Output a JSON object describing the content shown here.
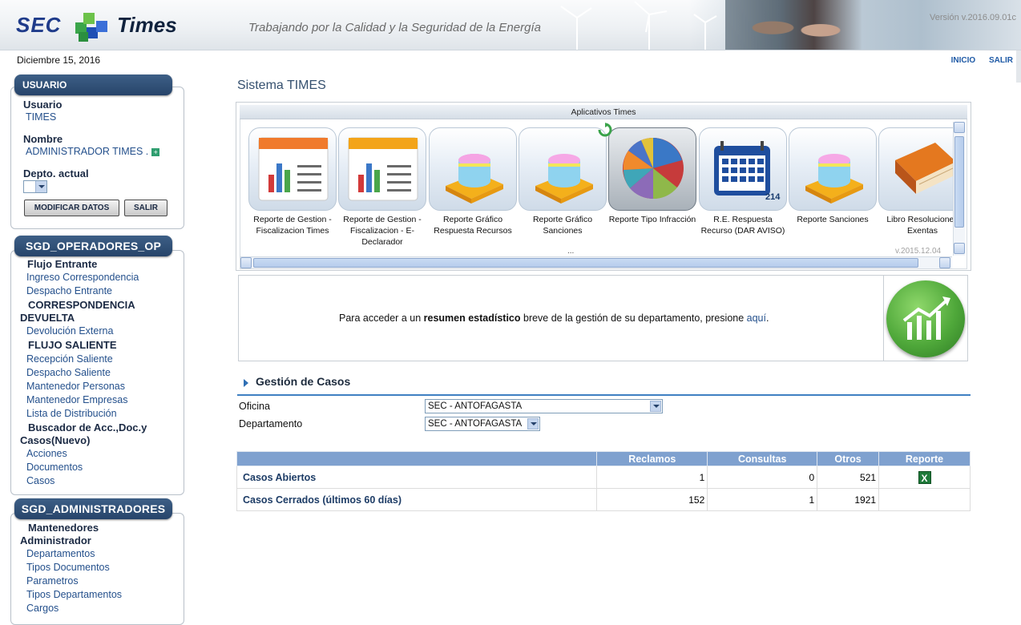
{
  "header": {
    "logo_sec": "SEC",
    "logo_times": "Times",
    "tagline": "Trabajando por la Calidad y la Seguridad de la Energía",
    "version": "Versión v.2016.09.01c"
  },
  "date": "Diciembre 15, 2016",
  "top_links": {
    "inicio": "INICIO",
    "salir": "SALIR"
  },
  "user_panel": {
    "tab": "USUARIO",
    "usuario_label": "Usuario",
    "usuario_value": "TIMES",
    "nombre_label": "Nombre",
    "nombre_value": "ADMINISTRADOR TIMES .",
    "depto_label": "Depto. actual",
    "modificar_button": "MODIFICAR DATOS",
    "salir_button": "SALIR"
  },
  "operadores_panel": {
    "tab": "SGD_OPERADORES_OP",
    "items": {
      "flujo_entrante": "Flujo Entrante",
      "ingreso_correspondencia": "Ingreso Correspondencia",
      "despacho_entrante": "Despacho Entrante",
      "correspondencia_devuelta_1": "CORRESPONDENCIA",
      "correspondencia_devuelta_2": "DEVUELTA",
      "devolucion_externa": "Devolución Externa",
      "flujo_saliente": "FLUJO SALIENTE",
      "recepcion_saliente": "Recepción Saliente",
      "despacho_saliente": "Despacho Saliente",
      "mantenedor_personas": "Mantenedor Personas",
      "mantenedor_empresas": "Mantenedor Empresas",
      "lista_distribucion": "Lista de Distribución",
      "buscador_1": "Buscador de Acc.,Doc.y",
      "buscador_2": "Casos(Nuevo)",
      "acciones": "Acciones",
      "documentos": "Documentos",
      "casos": "Casos"
    }
  },
  "administradores_panel": {
    "tab": "SGD_ADMINISTRADORES",
    "items": {
      "mantenedores_1": "Mantenedores",
      "mantenedores_2": "Administrador",
      "departamentos": "Departamentos",
      "tipos_documentos": "Tipos Documentos",
      "parametros": "Parametros",
      "tipos_departamentos": "Tipos Departamentos",
      "cargos": "Cargos"
    }
  },
  "main": {
    "title": "Sistema TIMES",
    "apps_title": "Aplicativos Times",
    "apps": [
      {
        "label": "Reporte de Gestion - Fiscalizacion Times",
        "icon": "report-chart-icon"
      },
      {
        "label": "Reporte de Gestion - Fiscalizacion - E-Declarador",
        "icon": "report-chart-icon"
      },
      {
        "label": "Reporte Gráfico Respuesta Recursos",
        "icon": "database-book-icon"
      },
      {
        "label": "Reporte Gráfico Sanciones",
        "icon": "database-book-icon"
      },
      {
        "label": "Reporte Tipo Infracción",
        "icon": "pie-chart-icon"
      },
      {
        "label": "R.E. Respuesta Recurso (DAR AVISO)",
        "icon": "calendar-icon",
        "badge": "214"
      },
      {
        "label": "Reporte Sanciones",
        "icon": "database-book-icon"
      },
      {
        "label": "Libro Resoluciones Exentas",
        "icon": "book-icon"
      }
    ],
    "apps_ellipsis": "...",
    "apps_version": "v.2015.12.04",
    "stat_prefix": "Para acceder a un ",
    "stat_bold": "resumen estadístico",
    "stat_middle": " breve de la gestión de su departamento, presione ",
    "stat_link": "aquí",
    "stat_suffix": ".",
    "cases_title": "Gestión de Casos",
    "oficina_label": "Oficina",
    "oficina_value": "SEC - ANTOFAGASTA",
    "departamento_label": "Departamento",
    "departamento_value": "SEC - ANTOFAGASTA",
    "table": {
      "headers": [
        "",
        "Reclamos",
        "Consultas",
        "Otros",
        "Reporte"
      ],
      "rows": [
        {
          "label": "Casos Abiertos",
          "reclamos": "1",
          "consultas": "0",
          "otros": "521"
        },
        {
          "label": "Casos Cerrados (últimos 60 días)",
          "reclamos": "152",
          "consultas": "1",
          "otros": "1921"
        }
      ]
    }
  },
  "colors": {
    "nav_tab": "#27446a",
    "link": "#24508c",
    "table_header": "#7fa1cf",
    "accent_line": "#3f80c2"
  }
}
